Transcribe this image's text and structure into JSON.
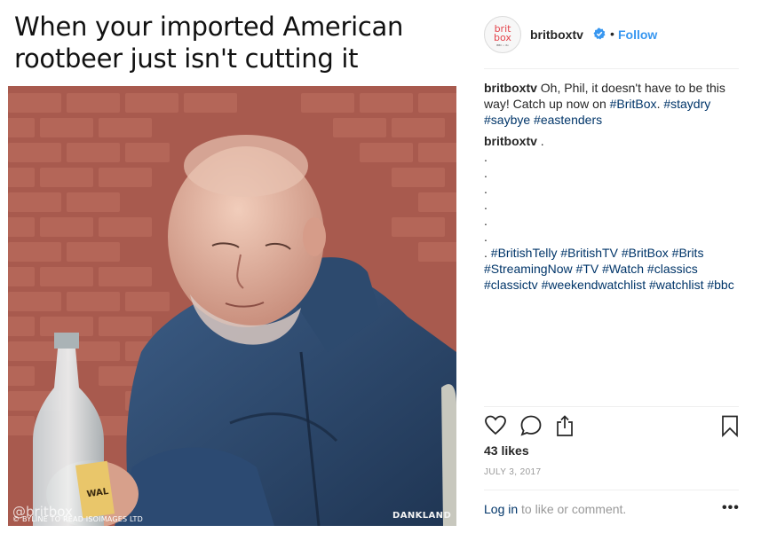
{
  "meme": {
    "caption_line1": "When your imported American",
    "caption_line2": "rootbeer just isn't cutting it",
    "watermark_left": "@britbox",
    "watermark_byline": "© BYLINE TO READ ISOIMAGES LTD",
    "watermark_right": "DANKLAND",
    "bottle_label": "WAL"
  },
  "post": {
    "avatar_text_top": "brit",
    "avatar_text_bottom": "box",
    "avatar_text_small": "BBC • itv",
    "username": "britboxtv",
    "separator": "•",
    "follow_label": "Follow",
    "caption_user": "britboxtv",
    "caption_text": "Oh, Phil, it doesn't have to be this way! Catch up now on",
    "caption_tag1": "#BritBox",
    "caption_after": ".",
    "caption_tag2": "#staydry",
    "caption_tag3": "#saybye",
    "caption_tag4": "#eastenders",
    "comment_user": "britboxtv",
    "comment_first": ".",
    "comment_dots": [
      ".",
      ".",
      ".",
      ".",
      ".",
      "."
    ],
    "comment_lead": ".",
    "hashtags": [
      "#BritishTelly",
      "#BritishTV",
      "#BritBox",
      "#Brits",
      "#StreamingNow",
      "#TV",
      "#Watch",
      "#classics",
      "#classictv",
      "#weekendwatchlist",
      "#watchlist",
      "#bbc"
    ],
    "likes": "43 likes",
    "date": "JULY 3, 2017",
    "login_link": "Log in",
    "login_rest": " to like or comment.",
    "more_label": "•••"
  },
  "colors": {
    "link": "#003569",
    "follow": "#3897f0",
    "muted": "#999999"
  },
  "icons": [
    "verified-badge-icon",
    "heart-icon",
    "comment-icon",
    "share-icon",
    "bookmark-icon",
    "more-options-icon"
  ]
}
